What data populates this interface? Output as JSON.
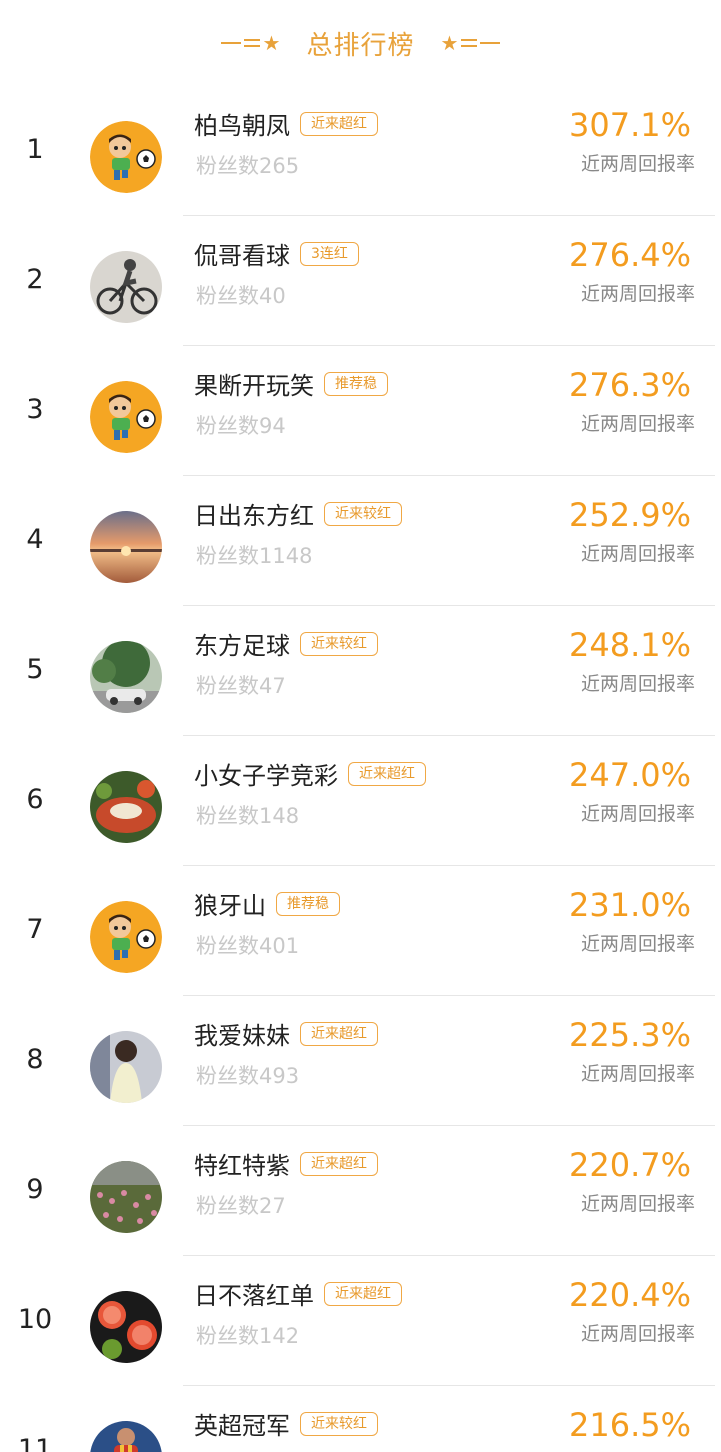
{
  "header": {
    "title": "总排行榜"
  },
  "rate_label": "近两周回报率",
  "list": [
    {
      "rank": "1",
      "name": "柏鸟朝凤",
      "badge": "近来超红",
      "fans": "粉丝数265",
      "rate": "307.1%",
      "avatar": "soccer-kid-avatar"
    },
    {
      "rank": "2",
      "name": "侃哥看球",
      "badge": "3连红",
      "fans": "粉丝数40",
      "rate": "276.4%",
      "avatar": "cyclist-photo-avatar"
    },
    {
      "rank": "3",
      "name": "果断开玩笑",
      "badge": "推荐稳",
      "fans": "粉丝数94",
      "rate": "276.3%",
      "avatar": "soccer-kid-avatar"
    },
    {
      "rank": "4",
      "name": "日出东方红",
      "badge": "近来较红",
      "fans": "粉丝数1148",
      "rate": "252.9%",
      "avatar": "sunset-photo-avatar"
    },
    {
      "rank": "5",
      "name": "东方足球",
      "badge": "近来较红",
      "fans": "粉丝数47",
      "rate": "248.1%",
      "avatar": "street-car-photo-avatar"
    },
    {
      "rank": "6",
      "name": "小女子学竞彩",
      "badge": "近来超红",
      "fans": "粉丝数148",
      "rate": "247.0%",
      "avatar": "food-photo-avatar"
    },
    {
      "rank": "7",
      "name": "狼牙山",
      "badge": "推荐稳",
      "fans": "粉丝数401",
      "rate": "231.0%",
      "avatar": "soccer-kid-avatar"
    },
    {
      "rank": "8",
      "name": "我爱妹妹",
      "badge": "近来超红",
      "fans": "粉丝数493",
      "rate": "225.3%",
      "avatar": "girl-photo-avatar"
    },
    {
      "rank": "9",
      "name": "特红特紫",
      "badge": "近来超红",
      "fans": "粉丝数27",
      "rate": "220.7%",
      "avatar": "flowers-photo-avatar"
    },
    {
      "rank": "10",
      "name": "日不落红单",
      "badge": "近来超红",
      "fans": "粉丝数142",
      "rate": "220.4%",
      "avatar": "citrus-photo-avatar"
    },
    {
      "rank": "11",
      "name": "英超冠军",
      "badge": "近来较红",
      "fans": "",
      "rate": "216.5%",
      "avatar": "football-player-photo-avatar"
    }
  ],
  "colors": {
    "accent": "#f39c1f",
    "badge_border": "#f0a845",
    "muted": "#c8c8c8"
  }
}
